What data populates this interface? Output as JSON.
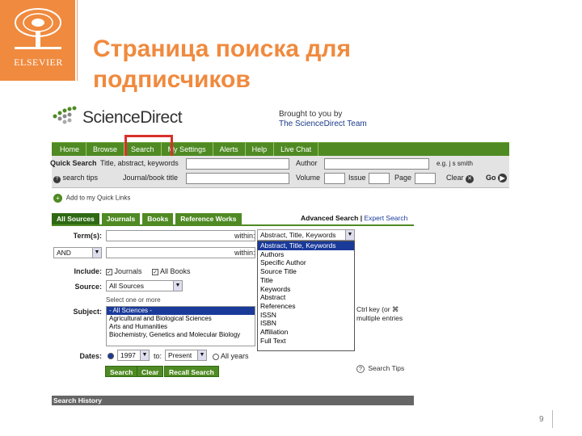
{
  "slide": {
    "title": "Страница поиска для подписчиков",
    "logo_text": "ELSEVIER",
    "page_number": "9"
  },
  "header": {
    "brand": "ScienceDirect",
    "brought_line1": "Brought to you by",
    "brought_line2": "The ScienceDirect Team"
  },
  "nav": {
    "items": [
      "Home",
      "Browse",
      "Search",
      "My Settings",
      "Alerts",
      "Help",
      "Live Chat"
    ]
  },
  "quick_search": {
    "label": "Quick Search",
    "terms_label": "Title, abstract, keywords",
    "author_label": "Author",
    "author_hint": "e.g. j s smith",
    "tips_label": "search tips",
    "journal_label": "Journal/book title",
    "volume_label": "Volume",
    "issue_label": "Issue",
    "page_label": "Page",
    "clear_label": "Clear",
    "go_label": "Go"
  },
  "quick_links": {
    "label": "Add to my Quick Links"
  },
  "tabs": [
    {
      "label": "All Sources",
      "active": true
    },
    {
      "label": "Journals",
      "active": false
    },
    {
      "label": "Books",
      "active": false
    },
    {
      "label": "Reference Works",
      "active": false
    }
  ],
  "adv_links": {
    "advanced": "Advanced Search",
    "separator": "|",
    "expert": "Expert Search"
  },
  "form": {
    "terms_label": "Term(s):",
    "within_label": "within:",
    "within_value": "Abstract, Title, Keywords",
    "within_label2": "within:",
    "operator_value": "AND",
    "include_label": "Include:",
    "include_journals": "Journals",
    "include_books": "All Books",
    "source_label": "Source:",
    "source_value": "All Sources",
    "subject_label": "Subject:",
    "subject_hint": "Select one or more",
    "subjects": [
      "- All Sciences -",
      "Agricultural and Biological Sciences",
      "Arts and Humanities",
      "Biochemistry, Genetics and Molecular Biology"
    ],
    "dates_label": "Dates:",
    "date_from": "1997",
    "to_label": "to:",
    "date_to": "Present",
    "all_years": "All years",
    "search_btn": "Search",
    "clear_btn": "Clear",
    "recall_btn": "Recall Search",
    "note_line1": "Ctrl key (or ⌘",
    "note_line2": "multiple entries",
    "search_tips": "Search Tips"
  },
  "dropdown": {
    "options": [
      "Abstract, Title, Keywords",
      "Authors",
      "Specific Author",
      "Source Title",
      "Title",
      "Keywords",
      "Abstract",
      "References",
      "ISSN",
      "ISBN",
      "Affiliation",
      "Full Text"
    ]
  },
  "history": {
    "label": "Search History"
  },
  "colors": {
    "brand_orange": "#f08a3e",
    "nav_green": "#4f8a23",
    "highlight_red": "#d9302a"
  }
}
